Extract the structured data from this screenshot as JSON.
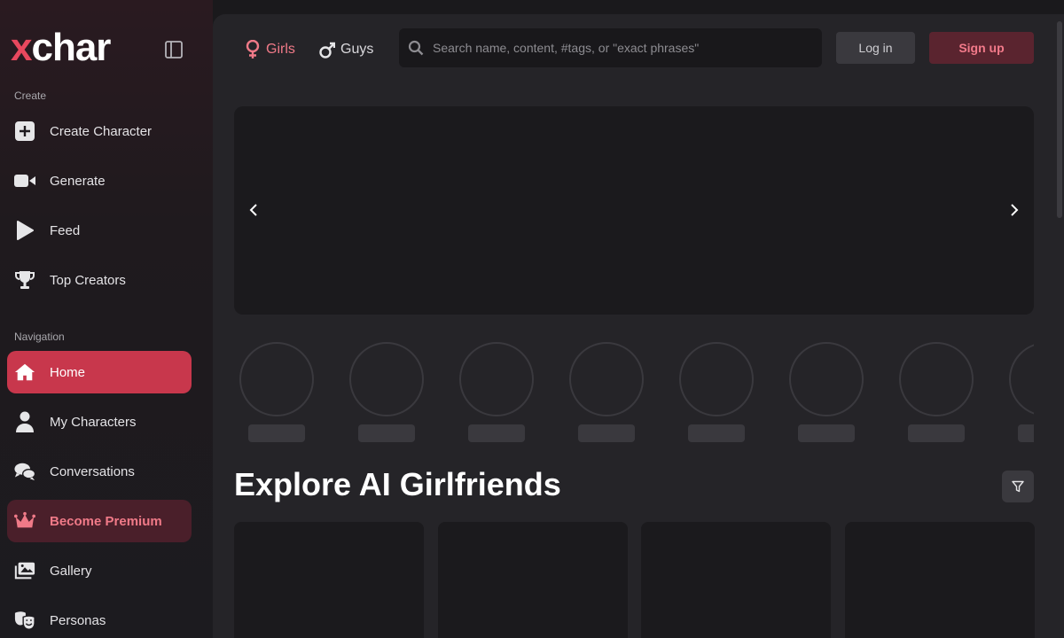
{
  "brand": {
    "logo_x": "x",
    "logo_rest": "char"
  },
  "sidebar": {
    "create_label": "Create",
    "navigation_label": "Navigation",
    "create_items": [
      {
        "label": "Create Character",
        "icon": "plus-square-icon"
      },
      {
        "label": "Generate",
        "icon": "video-camera-icon"
      },
      {
        "label": "Feed",
        "icon": "play-icon"
      },
      {
        "label": "Top Creators",
        "icon": "trophy-icon"
      }
    ],
    "nav_items": [
      {
        "label": "Home",
        "icon": "home-icon",
        "active": true
      },
      {
        "label": "My Characters",
        "icon": "user-icon"
      },
      {
        "label": "Conversations",
        "icon": "chat-bubbles-icon"
      },
      {
        "label": "Become Premium",
        "icon": "crown-icon",
        "premium": true
      },
      {
        "label": "Gallery",
        "icon": "images-icon"
      },
      {
        "label": "Personas",
        "icon": "theater-masks-icon"
      }
    ]
  },
  "header": {
    "tab_girls": "Girls",
    "tab_guys": "Guys",
    "search_placeholder": "Search name, content, #tags, or \"exact phrases\"",
    "login_label": "Log in",
    "signup_label": "Sign up"
  },
  "main": {
    "section_title": "Explore AI Girlfriends"
  },
  "colors": {
    "accent": "#c8374c",
    "accent_text": "#f07a88",
    "panel": "#252428",
    "background": "#1a191c"
  }
}
